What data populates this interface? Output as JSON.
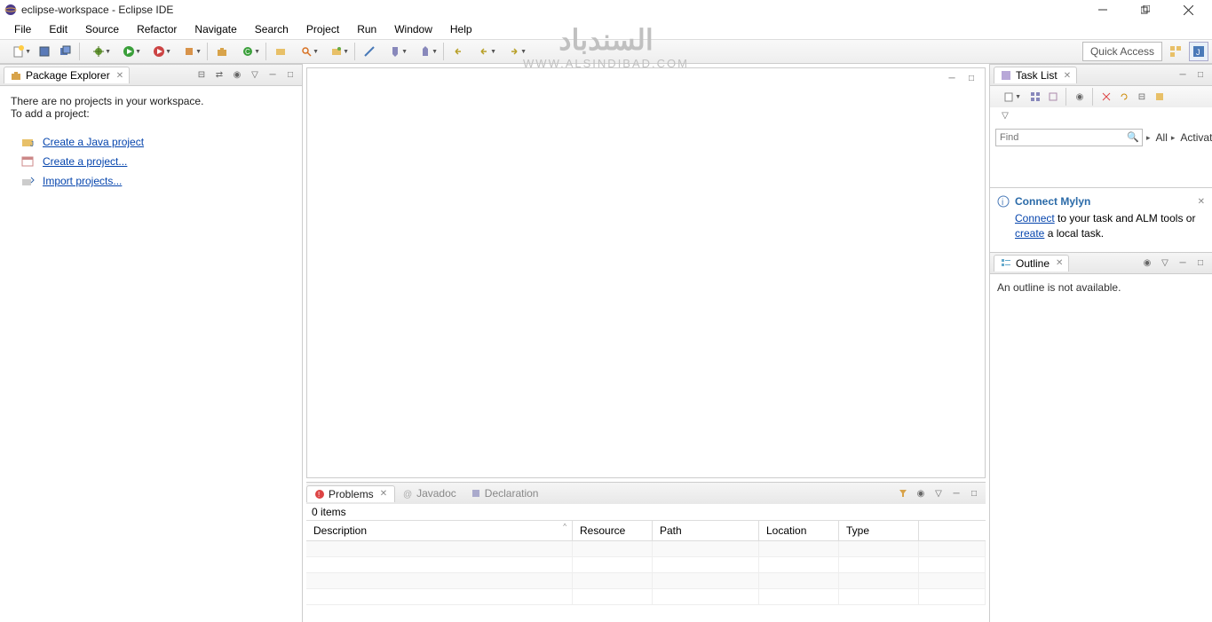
{
  "title": "eclipse-workspace - Eclipse IDE",
  "menu": [
    "File",
    "Edit",
    "Source",
    "Refactor",
    "Navigate",
    "Search",
    "Project",
    "Run",
    "Window",
    "Help"
  ],
  "quick_access": "Quick Access",
  "package_explorer": {
    "title": "Package Explorer",
    "msg1": "There are no projects in your workspace.",
    "msg2": "To add a project:",
    "links": {
      "create_java": "Create a Java project",
      "create_proj": "Create a project...",
      "import_proj": "Import projects..."
    }
  },
  "task_list": {
    "title": "Task List",
    "find_placeholder": "Find",
    "all": "All",
    "activate": "Activate...",
    "mylyn_title": "Connect Mylyn",
    "mylyn_connect": "Connect",
    "mylyn_text1": " to your task and ALM tools or ",
    "mylyn_create": "create",
    "mylyn_text2": " a local task."
  },
  "outline": {
    "title": "Outline",
    "msg": "An outline is not available."
  },
  "problems": {
    "tab_problems": "Problems",
    "tab_javadoc": "Javadoc",
    "tab_declaration": "Declaration",
    "count": "0 items",
    "cols": [
      "Description",
      "Resource",
      "Path",
      "Location",
      "Type"
    ]
  },
  "watermark": {
    "ar": "السندباد",
    "url": "WWW.ALSINDIBAD.COM"
  }
}
